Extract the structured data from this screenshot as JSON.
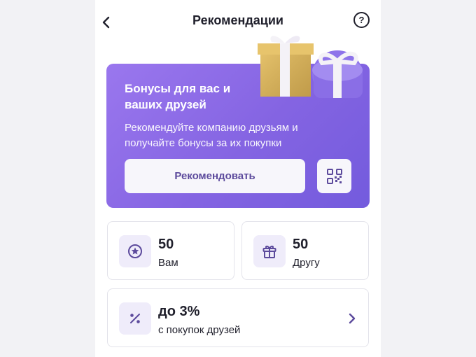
{
  "header": {
    "title": "Рекомендации",
    "back_icon": "chevron-left-icon",
    "help_label": "?"
  },
  "promo": {
    "title": "Бонусы для вас и ваших друзей",
    "description": "Рекомендуйте компанию друзьям и получайте бонусы за их покупки",
    "button_label": "Рекомендовать",
    "qr_icon": "qr-code-icon",
    "image": "gift-boxes",
    "accent_color": "#8464e2"
  },
  "stats": {
    "you": {
      "value": "50",
      "label": "Вам",
      "icon": "star-circle-icon"
    },
    "friend": {
      "value": "50",
      "label": "Другу",
      "icon": "gift-icon"
    }
  },
  "percent": {
    "value": "до 3%",
    "label": "с покупок друзей",
    "icon": "percent-icon",
    "chevron": "chevron-right-icon"
  }
}
